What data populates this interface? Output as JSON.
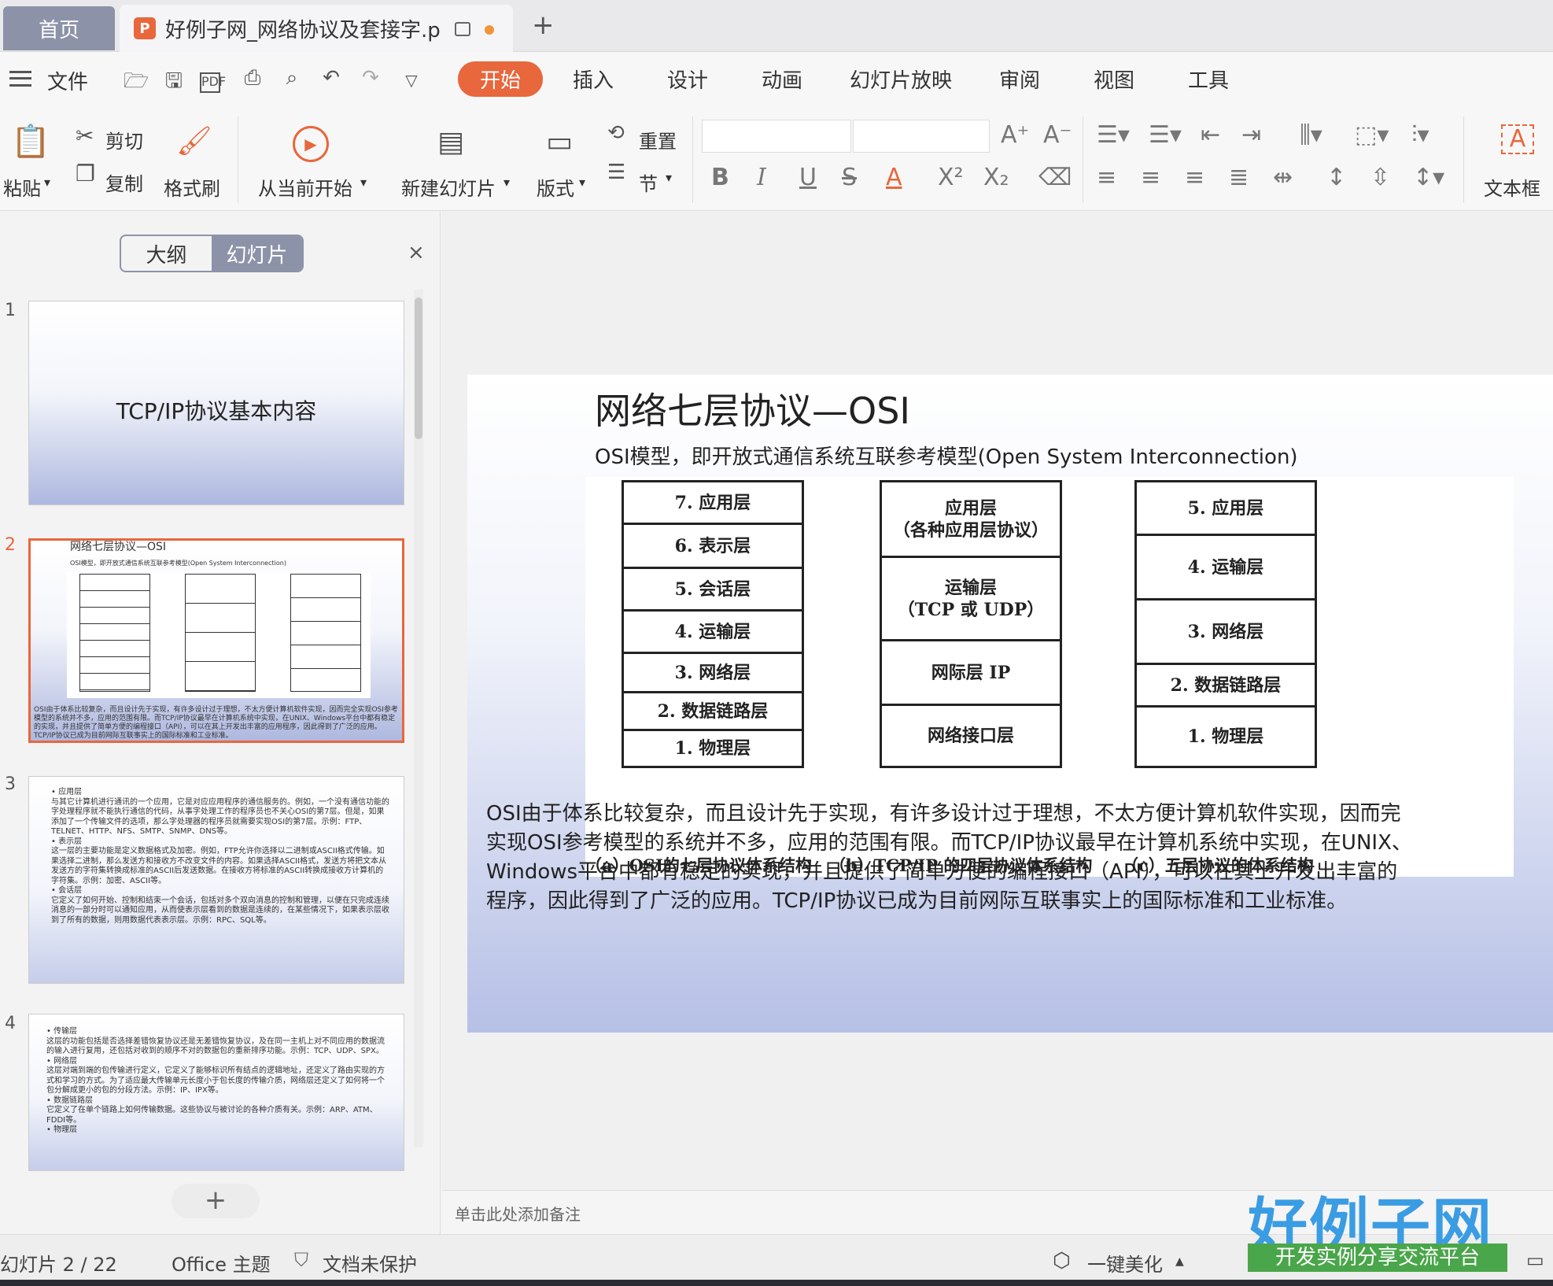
{
  "tabs": {
    "home": "首页",
    "doc_title": "好例子网_网络协议及套接字.p",
    "add": "+"
  },
  "menu": {
    "file": "文件",
    "tabs": [
      "开始",
      "插入",
      "设计",
      "动画",
      "幻灯片放映",
      "审阅",
      "视图",
      "工具"
    ],
    "active": "开始"
  },
  "ribbon": {
    "paste": "粘贴",
    "cut": "剪切",
    "copy": "复制",
    "format_painter": "格式刷",
    "from_start": "从当前开始",
    "new_slide": "新建幻灯片",
    "layout": "版式",
    "reset": "重置",
    "section": "节",
    "textbox": "文本框"
  },
  "left_panel": {
    "outline": "大纲",
    "slides": "幻灯片",
    "close": "×",
    "numbers": [
      "1",
      "2",
      "3",
      "4"
    ],
    "slide1_title": "TCP/IP协议基本内容",
    "slide2_title": "网络七层协议—OSI",
    "slide2_sub": "OSI模型，即开放式通信系统互联参考模型(Open System Interconnection)",
    "slide2_body": "OSI由于体系比较复杂，而且设计先于实现，有许多设计过于理想，不太方便计算机软件实现，因而完全实现OSI参考模型的系统并不多，应用的范围有限。而TCP/IP协议最早在计算机系统中实现，在UNIX、Windows平台中都有稳定的实现，并且提供了简单方便的编程接口（API），可以在其上开发出丰富的应用程序，因此得到了广泛的应用。TCP/IP协议已成为目前网际互联事实上的国际标准和工业标准。",
    "slide3_text": "• 应用层\n与其它计算机进行通讯的一个应用，它是对应应用程序的通信服务的。例如，一个没有通信功能的字处理程序就不能执行通信的代码，从事字处理工作的程序员也不关心OSI的第7层。但是，如果添加了一个传输文件的选项，那么字处理器的程序员就需要实现OSI的第7层。示例：FTP、TELNET、HTTP、NFS、SMTP、SNMP、DNS等。\n• 表示层\n这一层的主要功能是定义数据格式及加密。例如，FTP允许你选择以二进制或ASCII格式传输。如果选择二进制，那么发送方和接收方不改变文件的内容。如果选择ASCII格式，发送方将把文本从发送方的字符集转换成标准的ASCII后发送数据。在接收方将标准的ASCII转换成接收方计算机的字符集。示例：加密、ASCII等。\n• 会话层\n它定义了如何开始、控制和结束一个会话，包括对多个双向消息的控制和管理，以便在只完成连续消息的一部分时可以通知应用，从而使表示层看到的数据是连续的，在某些情况下，如果表示层收到了所有的数据，则用数据代表表示层。示例：RPC、SQL等。",
    "slide4_text": "• 传输层\n这层的功能包括是否选择差错恢复协议还是无差错恢复协议，及在同一主机上对不同应用的数据流的输入进行复用，还包括对收到的顺序不对的数据包的重新排序功能。示例：TCP、UDP、SPX。\n• 网络层\n这层对端到端的包传输进行定义，它定义了能够标识所有结点的逻辑地址，还定义了路由实现的方式和学习的方式。为了适应最大传输单元长度小于包长度的传输介质，网络层还定义了如何将一个包分解成更小的包的分段方法。示例：IP、IPX等。\n• 数据链路层\n它定义了在单个链路上如何传输数据。这些协议与被讨论的各种介质有关。示例：ARP、ATM、FDDI等。\n• 物理层",
    "add_slide": "+"
  },
  "slide": {
    "title": "网络七层协议—OSI",
    "subtitle": "OSI模型，即开放式通信系统互联参考模型(Open  System  Interconnection)",
    "osi_layers": [
      "7. 应用层",
      "6. 表示层",
      "5. 会话层",
      "4. 运输层",
      "3. 网络层",
      "2. 数据链路层",
      "1. 物理层"
    ],
    "tcpip_layers": [
      "应用层\n（各种应用层协议）",
      "运输层\n（TCP 或 UDP）",
      "网际层 IP",
      "网络接口层"
    ],
    "five_layers": [
      "5. 应用层",
      "4. 运输层",
      "3. 网络层",
      "2. 数据链路层",
      "1. 物理层"
    ],
    "caption_a": "（a）OSI的七层协议体系结构",
    "caption_b": "（b）TCP/IP 的四层协议体系结构",
    "caption_c": "（c）五层协议的体系结构",
    "body": "OSI由于体系比较复杂，而且设计先于实现，有许多设计过于理想，不太方便计算机软件实现，因而完\n实现OSI参考模型的系统并不多，应用的范围有限。而TCP/IP协议最早在计算机系统中实现，在UNIX、\nWindows平台中都有稳定的实现，并且提供了简单方便的编程接口（API），可以在其上开发出丰富的\n程序，因此得到了广泛的应用。TCP/IP协议已成为目前网际互联事实上的国际标准和工业标准。"
  },
  "notes_placeholder": "单击此处添加备注",
  "status": {
    "slide_count": "幻灯片 2 / 22",
    "theme": "Office 主题",
    "protect": "文档未保护",
    "beautify": "一键美化"
  },
  "logo": {
    "big": "好例子网",
    "small": "开发实例分享交流平台"
  },
  "colors": {
    "accent": "#e8673c",
    "tab_home": "#8c93a8"
  }
}
